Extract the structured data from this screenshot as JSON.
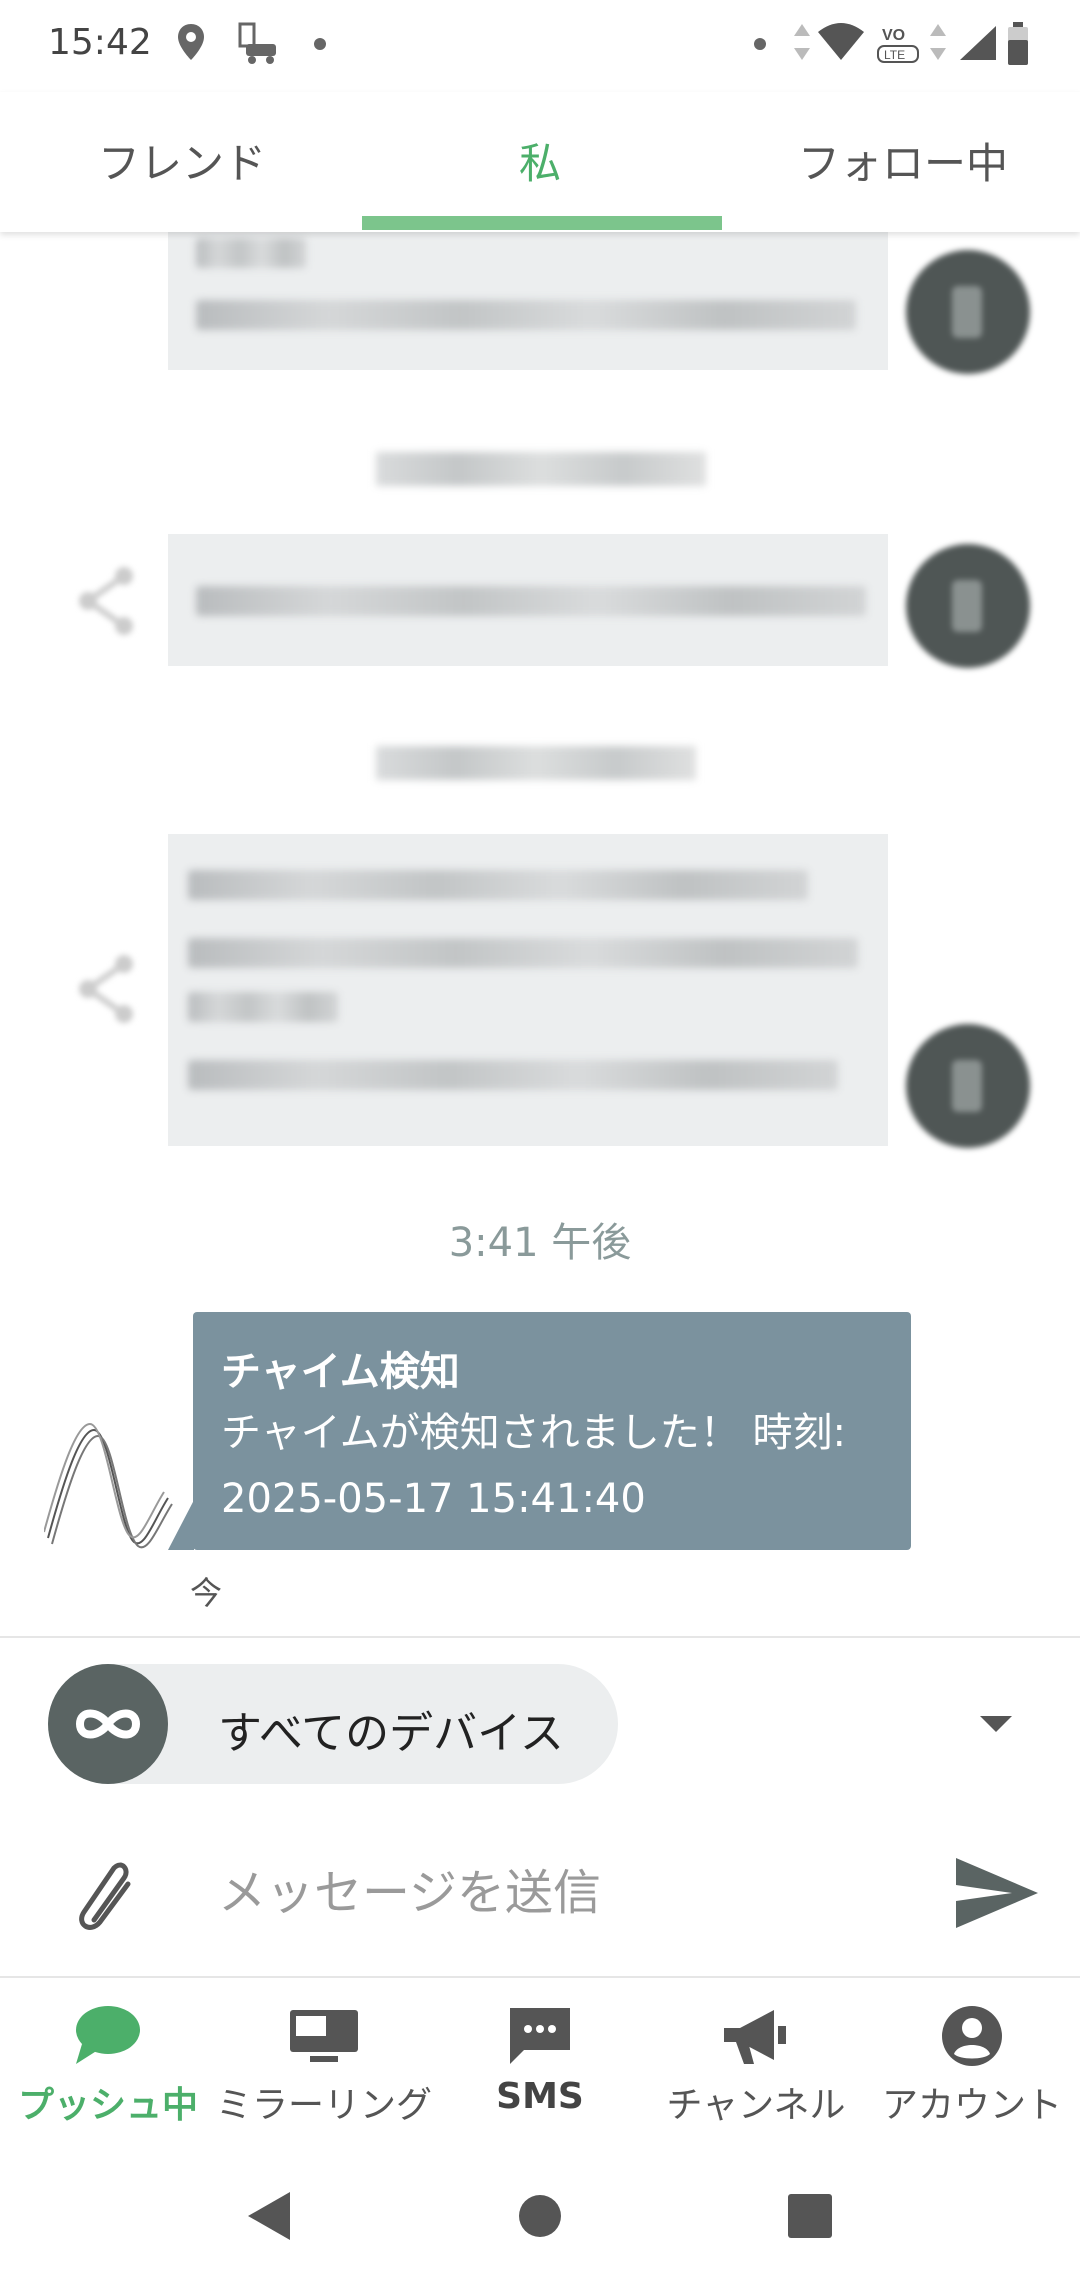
{
  "status_bar": {
    "time": "15:42"
  },
  "tabs": [
    {
      "label": "フレンド"
    },
    {
      "label": "私"
    },
    {
      "label": "フォロー中"
    }
  ],
  "conversation": {
    "timestamp": "3:41 午後",
    "message": {
      "title": "チャイム検知",
      "body": "チャイムが検知されました！ 時刻: 2025-05-17 15:41:40",
      "relative_time": "今"
    }
  },
  "device_selector": {
    "label": "すべてのデバイス"
  },
  "compose": {
    "placeholder": "メッセージを送信"
  },
  "bottom_nav": [
    {
      "label": "プッシュ中",
      "icon": "chat-bubble-icon"
    },
    {
      "label": "ミラーリング",
      "icon": "monitor-icon"
    },
    {
      "label": "SMS",
      "icon": "sms-icon"
    },
    {
      "label": "チャンネル",
      "icon": "megaphone-icon"
    },
    {
      "label": "アカウント",
      "icon": "account-circle-icon"
    }
  ],
  "colors": {
    "accent_green": "#4caf6a",
    "message_bubble": "#7b929e",
    "device_circle": "#5a6463"
  }
}
